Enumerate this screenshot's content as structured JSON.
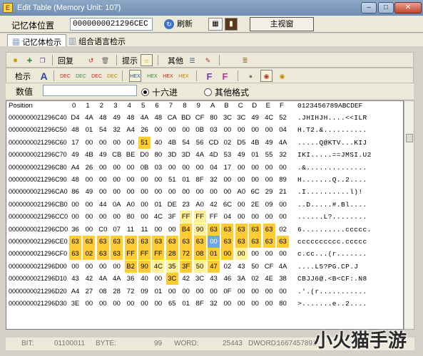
{
  "window": {
    "title": "Edit Table (Memory Unit: 107)",
    "minimize": "–",
    "maximize": "□",
    "close": "✕"
  },
  "address_bar": {
    "label": "记忆体位置",
    "value": "0000000021296CEC",
    "refresh_label": "刷新",
    "main_view_label": "主视窗"
  },
  "tabs": [
    {
      "label": "记忆体检示",
      "active": true
    },
    {
      "label": "组合语言检示",
      "active": false
    }
  ],
  "toolbar1": {
    "undo_label": "回复",
    "hint_label": "提示",
    "other_label": "其他"
  },
  "toolbar2": {
    "hint_label": "检示",
    "icon_labels": [
      "DEC",
      "DEC",
      "DEC",
      "DEC",
      "DEC",
      "HEX",
      "HEX",
      "HEX",
      "HEX"
    ]
  },
  "value_bar": {
    "label": "数值",
    "input_value": "",
    "radio_hex": "十六进",
    "radio_other": "其他格式",
    "selected": "hex"
  },
  "grid": {
    "position_header": "Position",
    "hex_headers": [
      "0",
      "1",
      "2",
      "3",
      "4",
      "5",
      "6",
      "7",
      "8",
      "9",
      "A",
      "B",
      "C",
      "D",
      "E",
      "F"
    ],
    "ascii_header": "0123456789ABCDEF",
    "rows": [
      {
        "addr": "0000000021296C40",
        "bytes": [
          "D4",
          "4A",
          "48",
          "49",
          "48",
          "4A",
          "48",
          "CA",
          "BD",
          "CF",
          "80",
          "3C",
          "3C",
          "49",
          "4C",
          "52"
        ],
        "ascii": ".JHIHJH....<<ILR"
      },
      {
        "addr": "0000000021296C50",
        "bytes": [
          "48",
          "01",
          "54",
          "32",
          "A4",
          "26",
          "00",
          "00",
          "00",
          "0B",
          "03",
          "00",
          "00",
          "00",
          "00",
          "04"
        ],
        "ascii": "H.T2.&.........."
      },
      {
        "addr": "0000000021296C60",
        "bytes": [
          "17",
          "00",
          "00",
          "00",
          "00",
          "51",
          "40",
          "4B",
          "54",
          "56",
          "CD",
          "02",
          "D5",
          "4B",
          "49",
          "4A"
        ],
        "ascii": ".....Q@KTV...KIJ"
      },
      {
        "addr": "0000000021296C70",
        "addr_full": "0000000021296C70",
        "bytes": [
          "49",
          "4B",
          "49",
          "CB",
          "BE",
          "D0",
          "80",
          "3D",
          "3D",
          "4A",
          "4D",
          "53",
          "49",
          "01",
          "55",
          "32"
        ],
        "ascii": "IKI.....==JMSI.U2"
      },
      {
        "addr": "0000000021296C80",
        "bytes": [
          "A4",
          "26",
          "00",
          "00",
          "00",
          "0B",
          "03",
          "00",
          "00",
          "00",
          "04",
          "17",
          "00",
          "00",
          "00",
          "00"
        ],
        "ascii": ".&.............."
      },
      {
        "addr": "0000000021296C90",
        "bytes": [
          "48",
          "00",
          "00",
          "00",
          "00",
          "00",
          "00",
          "51",
          "01",
          "8F",
          "32",
          "00",
          "00",
          "00",
          "00",
          "89"
        ],
        "ascii": "H.......Q..2...."
      },
      {
        "addr": "0000000021296CA0",
        "bytes": [
          "86",
          "49",
          "00",
          "00",
          "00",
          "00",
          "00",
          "00",
          "00",
          "00",
          "00",
          "00",
          "A0",
          "6C",
          "29",
          "21"
        ],
        "ascii": ".I..........l)!"
      },
      {
        "addr": "0000000021296CB0",
        "bytes": [
          "00",
          "00",
          "44",
          "0A",
          "A0",
          "00",
          "01",
          "DE",
          "23",
          "A0",
          "42",
          "6C",
          "00",
          "2E",
          "09",
          "00"
        ],
        "ascii": "..D.....#.Bl...."
      },
      {
        "addr": "0000000021296CC0",
        "bytes": [
          "00",
          "00",
          "00",
          "00",
          "80",
          "00",
          "4C",
          "3F",
          "FF",
          "FF",
          "FF",
          "04",
          "00",
          "00",
          "00",
          "00"
        ],
        "ascii": "......L?........"
      },
      {
        "addr": "0000000021296CD0",
        "bytes": [
          "36",
          "00",
          "C0",
          "07",
          "11",
          "11",
          "00",
          "00",
          "B4",
          "90",
          "63",
          "63",
          "63",
          "63",
          "63",
          "02"
        ],
        "ascii": "6..........ccccc."
      },
      {
        "addr": "0000000021296CE0",
        "bytes": [
          "63",
          "63",
          "63",
          "63",
          "63",
          "63",
          "63",
          "63",
          "63",
          "63",
          "00",
          "63",
          "63",
          "63",
          "63",
          "63"
        ],
        "ascii": "cccccccccc.ccccc"
      },
      {
        "addr": "0000000021296CF0",
        "bytes": [
          "63",
          "02",
          "63",
          "63",
          "FF",
          "FF",
          "FF",
          "28",
          "72",
          "08",
          "01",
          "00",
          "00",
          "00",
          "00",
          "00"
        ],
        "ascii": "c.cc...(r......."
      },
      {
        "addr": "0000000021296D00",
        "bytes": [
          "00",
          "00",
          "00",
          "00",
          "B2",
          "90",
          "4C",
          "35",
          "3F",
          "50",
          "47",
          "02",
          "43",
          "50",
          "CF",
          "4A"
        ],
        "ascii": "....L5?PG.CP.J"
      },
      {
        "addr": "0000000021296D10",
        "bytes": [
          "43",
          "42",
          "4A",
          "4A",
          "36",
          "40",
          "00",
          "3C",
          "42",
          "3C",
          "43",
          "46",
          "3A",
          "02",
          "4E",
          "38"
        ],
        "ascii": "CBJJ6@.<B<CF:.N8"
      },
      {
        "addr": "0000000021296D20",
        "bytes": [
          "A4",
          "27",
          "08",
          "28",
          "72",
          "09",
          "01",
          "00",
          "00",
          "00",
          "00",
          "0F",
          "00",
          "00",
          "00",
          "00"
        ],
        "ascii": ".'.(r..........."
      },
      {
        "addr": "0000000021296D30",
        "bytes": [
          "3E",
          "00",
          "00",
          "00",
          "00",
          "00",
          "00",
          "65",
          "01",
          "8F",
          "32",
          "00",
          "00",
          "00",
          "00",
          "80"
        ],
        "ascii": ">.......e..2...."
      }
    ]
  },
  "status": {
    "bit_label": "BIT:",
    "bit_value": "01100011",
    "byte_label": "BYTE:",
    "byte_value": "99",
    "word_label": "WORD:",
    "word_value": "25443",
    "dword_label": "DWORD:",
    "dword_value": "1667457891"
  },
  "watermark": "小火猫手游网"
}
